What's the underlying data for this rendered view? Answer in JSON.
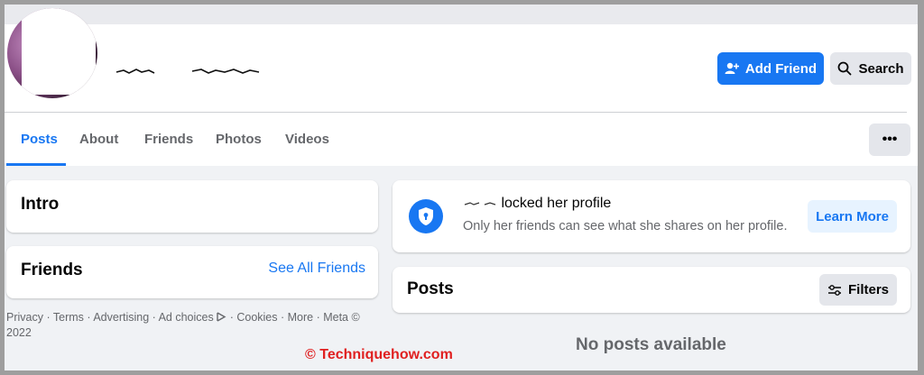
{
  "header": {
    "add_friend_label": "Add Friend",
    "search_label": "Search",
    "more_label": "•••"
  },
  "tabs": [
    {
      "label": "Posts",
      "active": true
    },
    {
      "label": "About",
      "active": false
    },
    {
      "label": "Friends",
      "active": false
    },
    {
      "label": "Photos",
      "active": false
    },
    {
      "label": "Videos",
      "active": false
    }
  ],
  "sidebar": {
    "intro_title": "Intro",
    "friends_title": "Friends",
    "see_all_friends": "See All Friends"
  },
  "footer": {
    "links": [
      "Privacy",
      "Terms",
      "Advertising",
      "Ad choices",
      "Cookies",
      "More",
      "Meta © 2022"
    ]
  },
  "locked_notice": {
    "title": "locked her profile",
    "subtitle": "Only her friends can see what she shares on her profile.",
    "learn_more_label": "Learn More"
  },
  "posts": {
    "title": "Posts",
    "filters_label": "Filters",
    "empty_message": "No posts available"
  },
  "watermark": "© Techniquehow.com",
  "colors": {
    "accent": "#1877f2",
    "page_bg": "#f0f2f5",
    "card_bg": "#ffffff",
    "muted_text": "#65676b",
    "watermark": "#e02020"
  },
  "icons": {
    "add_friend": "person-plus-icon",
    "search": "search-icon",
    "lock": "shield-lock-icon",
    "filters": "sliders-icon",
    "ad_choices": "ad-choices-icon"
  }
}
